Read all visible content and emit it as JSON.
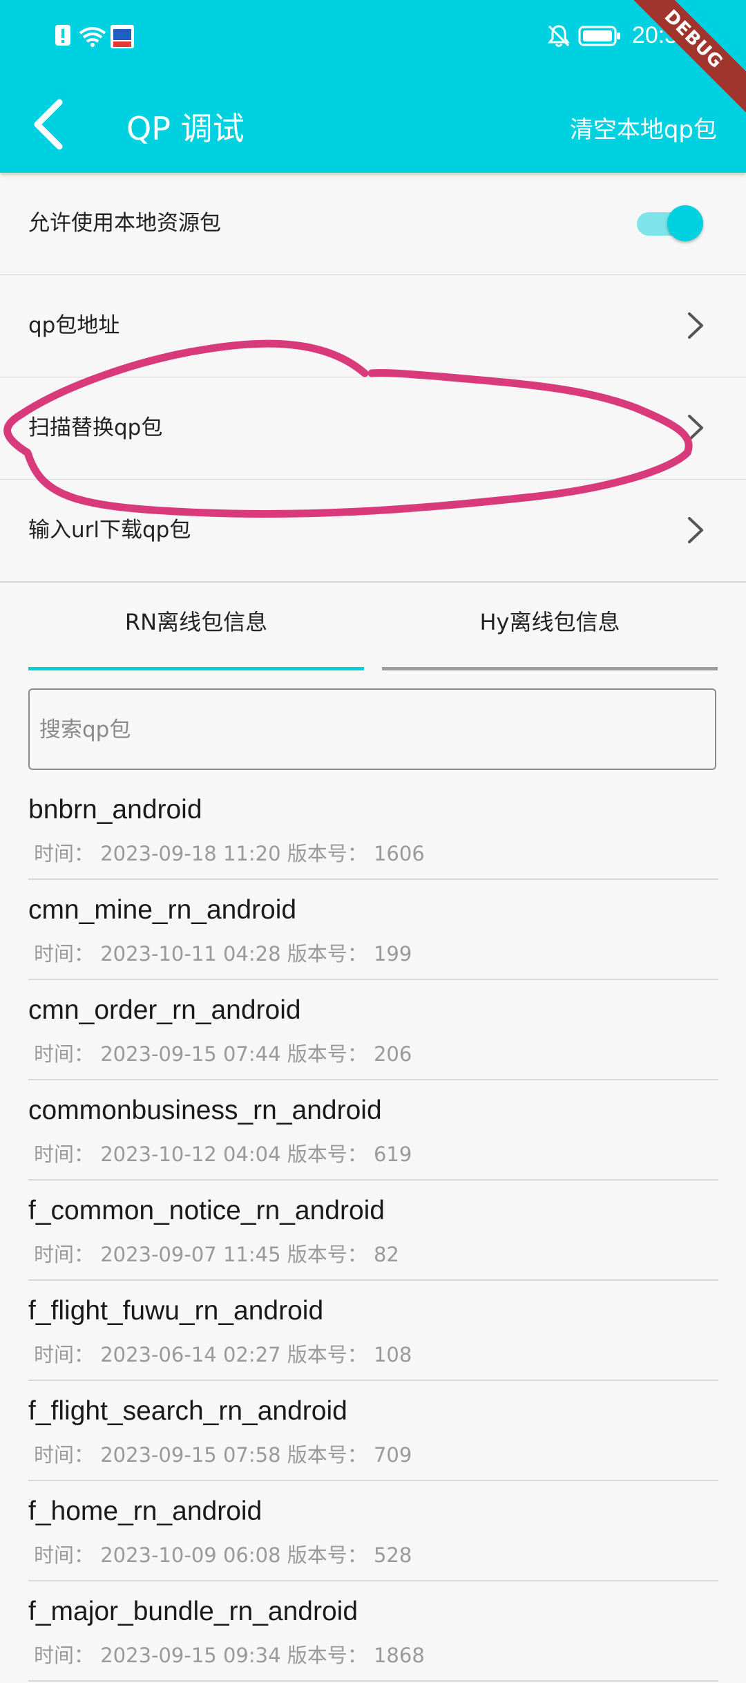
{
  "status_bar": {
    "time": "20:32",
    "debug_banner": "DEBUG"
  },
  "header": {
    "title": "QP 调试",
    "action": "清空本地qp包"
  },
  "settings": [
    {
      "label": "允许使用本地资源包",
      "type": "toggle",
      "value": true
    },
    {
      "label": "qp包地址",
      "type": "nav"
    },
    {
      "label": "扫描替换qp包",
      "type": "nav"
    },
    {
      "label": "输入url下载qp包",
      "type": "nav"
    }
  ],
  "tabs": [
    {
      "label": "RN离线包信息",
      "active": true
    },
    {
      "label": "Hy离线包信息",
      "active": false
    }
  ],
  "search": {
    "placeholder": "搜索qp包",
    "value": ""
  },
  "packages": [
    {
      "name": "bnbrn_android",
      "meta": "时间： 2023-09-18 11:20 版本号： 1606"
    },
    {
      "name": "cmn_mine_rn_android",
      "meta": "时间： 2023-10-11 04:28 版本号： 199"
    },
    {
      "name": "cmn_order_rn_android",
      "meta": "时间： 2023-09-15 07:44 版本号： 206"
    },
    {
      "name": "commonbusiness_rn_android",
      "meta": "时间： 2023-10-12 04:04 版本号： 619"
    },
    {
      "name": "f_common_notice_rn_android",
      "meta": "时间： 2023-09-07 11:45 版本号： 82"
    },
    {
      "name": "f_flight_fuwu_rn_android",
      "meta": "时间： 2023-06-14 02:27 版本号： 108"
    },
    {
      "name": "f_flight_search_rn_android",
      "meta": "时间： 2023-09-15 07:58 版本号： 709"
    },
    {
      "name": "f_home_rn_android",
      "meta": "时间： 2023-10-09 06:08 版本号： 528"
    },
    {
      "name": "f_major_bundle_rn_android",
      "meta": "时间： 2023-09-15 09:34 版本号： 1868"
    }
  ],
  "colors": {
    "accent": "#00d1e0",
    "annotation": "#d93a7c",
    "tab_inactive": "#9e9e9e"
  }
}
